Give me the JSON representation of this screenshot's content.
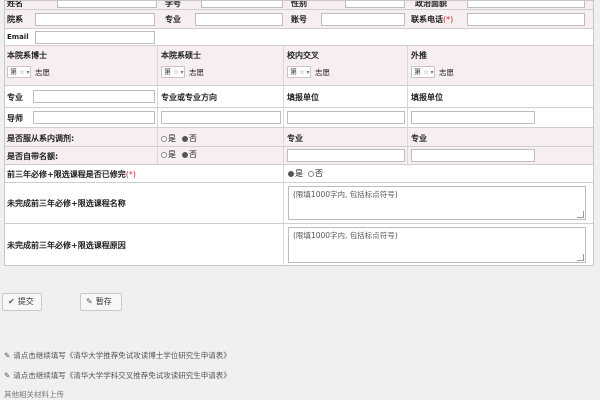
{
  "form": {
    "row0": {
      "name": "姓名",
      "student_no": "学号",
      "gender": "性别",
      "birth": "政治面貌"
    },
    "row1": {
      "dept": "院系",
      "major": "专业",
      "account": "账号",
      "phone": "联系电话",
      "req": "(*)"
    },
    "row2": {
      "email": "Email"
    },
    "row3": {
      "headers": [
        "本院系博士",
        "本院系硕士",
        "校内交叉",
        "外推"
      ],
      "select_values": [
        "第",
        "第",
        "第",
        "第"
      ],
      "select_suffix": "志愿"
    },
    "row4": {
      "major": "专业",
      "direction": "专业或专业方向",
      "unit_a": "填报单位",
      "unit_b": "填报单位"
    },
    "row5": {
      "tutor": "导师"
    },
    "row6": {
      "label": "是否服从系内调剂:",
      "yes": "是",
      "no": "否",
      "major_a": "专业",
      "major_b": "专业"
    },
    "row7": {
      "label": "是否自带名额:",
      "yes": "是",
      "no": "否"
    },
    "row8": {
      "label": "前三年必修+限选课程是否已修完",
      "req": "(*)",
      "yes": "是",
      "no": "否"
    },
    "row9": {
      "label": "未完成前三年必修+限选课程名称",
      "placeholder": "(限填1000字内, 包括标点符号)"
    },
    "row10": {
      "label": "未完成前三年必修+限选课程原因",
      "placeholder": "(限填1000字内, 包括标点符号)"
    }
  },
  "actions": {
    "submit": "提交",
    "save": "暂存"
  },
  "links": [
    "请点击继续填写《清华大学推荐免试攻读博士学位研究生申请表》",
    "请点击继续填写《清华大学学科交叉推荐免试攻读研究生申请表》"
  ],
  "footer": {
    "text": "其他相关材料上传"
  },
  "icons": {
    "radio": "radio-icon",
    "edit": "edit-icon",
    "check": "check-icon"
  }
}
